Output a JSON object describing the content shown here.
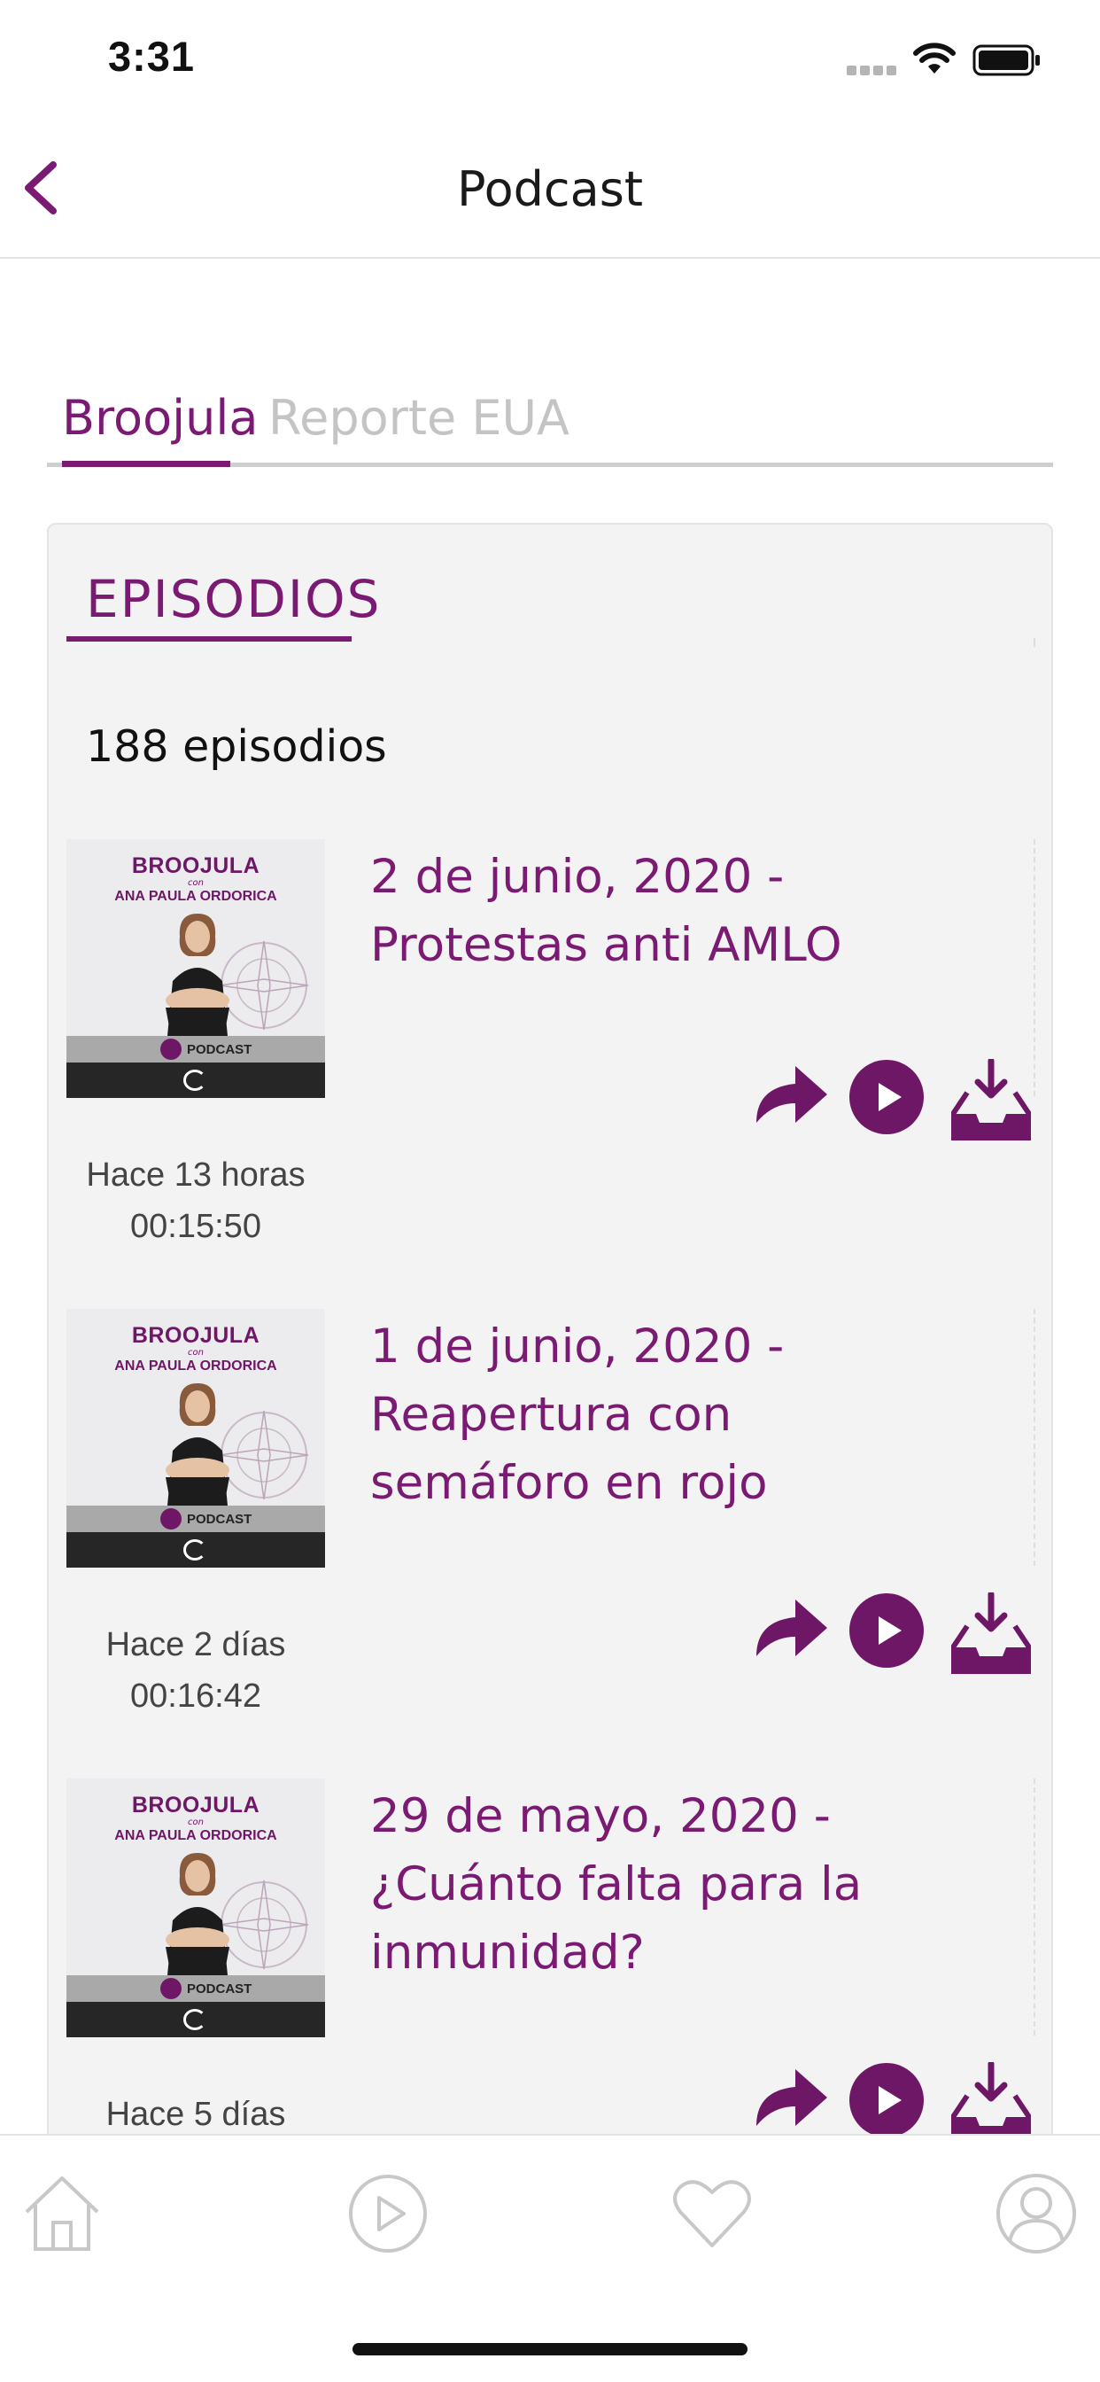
{
  "status_bar": {
    "time": "3:31",
    "icons": [
      "signal-icon",
      "wifi-icon",
      "battery-icon"
    ]
  },
  "nav": {
    "title": "Podcast",
    "back_icon": "chevron-left-icon"
  },
  "tabs": [
    {
      "label": "Broojula",
      "active": true
    },
    {
      "label": "Reporte EUA",
      "active": false
    }
  ],
  "section": {
    "title": "EPISODIOS",
    "count": "188 episodios"
  },
  "thumbnail": {
    "brand": "BROOJULA",
    "con": "con",
    "host": "ANA PAULA ORDORICA",
    "label": "PODCAST"
  },
  "episodes": [
    {
      "title": "2 de junio, 2020 - Protestas anti AMLO",
      "ago": "Hace 13 horas",
      "duration": "00:15:50"
    },
    {
      "title": "1 de junio, 2020 - Reapertura con semáforo en rojo",
      "ago": "Hace 2 días",
      "duration": "00:16:42"
    },
    {
      "title": "29 de mayo, 2020 - ¿Cuánto falta para la inmunidad?",
      "ago": "Hace 5 días",
      "duration": ""
    }
  ],
  "actions": {
    "share_icon": "share-icon",
    "play_icon": "play-icon",
    "download_icon": "download-icon"
  },
  "tab_bar": {
    "items": [
      "home-icon",
      "player-icon",
      "favorites-icon",
      "profile-icon"
    ]
  },
  "colors": {
    "accent": "#7a1a73",
    "inactive_tab": "#c4c4c4",
    "card_bg": "#f3f3f3",
    "tab_bar_icon": "#c8c8c8"
  }
}
